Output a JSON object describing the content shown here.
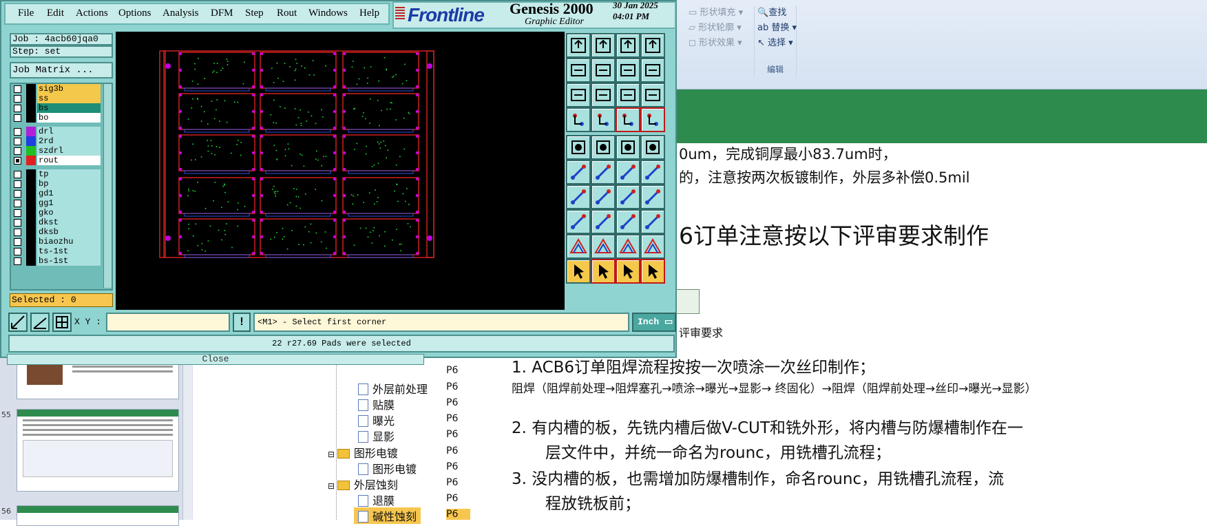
{
  "genesis": {
    "menu": [
      "File",
      "Edit",
      "Actions",
      "Options",
      "Analysis",
      "DFM",
      "Step",
      "Rout",
      "Windows",
      "Help"
    ],
    "brand": "Frontline",
    "product": "Genesis 2000",
    "subtitle": "Graphic Editor",
    "datetime_line1": "30 Jan 2025",
    "datetime_line2": "04:01 PM",
    "job_label": "Job : 4acb60jqa0",
    "step_label": "Step: set",
    "job_matrix_button": "Job Matrix ...",
    "layers": [
      {
        "name": "sig3b",
        "color": "#f4c84a",
        "swatch": "#000000"
      },
      {
        "name": "ss",
        "color": "#f4c84a",
        "swatch": "#000000"
      },
      {
        "name": "bs",
        "color": "#1e8f76",
        "swatch": "#000000"
      },
      {
        "name": "bo",
        "color": "#ffffff",
        "swatch": "#000000"
      },
      {
        "name": "drl",
        "color": "#a9e1de",
        "swatch": "#b020d8"
      },
      {
        "name": "2rd",
        "color": "#a9e1de",
        "swatch": "#2040e0"
      },
      {
        "name": "szdrl",
        "color": "#a9e1de",
        "swatch": "#20c020"
      },
      {
        "name": "rout",
        "color": "#ffffff",
        "swatch": "#e02020"
      },
      {
        "name": "tp",
        "color": "#a9e1de",
        "swatch": "#000000"
      },
      {
        "name": "bp",
        "color": "#a9e1de",
        "swatch": "#000000"
      },
      {
        "name": "gd1",
        "color": "#a9e1de",
        "swatch": "#000000"
      },
      {
        "name": "gg1",
        "color": "#a9e1de",
        "swatch": "#000000"
      },
      {
        "name": "gko",
        "color": "#a9e1de",
        "swatch": "#000000"
      },
      {
        "name": "dkst",
        "color": "#a9e1de",
        "swatch": "#000000"
      },
      {
        "name": "dksb",
        "color": "#a9e1de",
        "swatch": "#000000"
      },
      {
        "name": "biaozhu",
        "color": "#a9e1de",
        "swatch": "#000000"
      },
      {
        "name": "ts-1st",
        "color": "#a9e1de",
        "swatch": "#000000"
      },
      {
        "name": "bs-1st",
        "color": "#a9e1de",
        "swatch": "#000000"
      }
    ],
    "selected_label": "Selected : 0",
    "xy_label": "X Y :",
    "xy_value": "",
    "prompt": "<M1> - Select first corner",
    "units": "Inch",
    "status": "22 r27.69 Pads were selected",
    "close_label": "Close"
  },
  "ribbon": {
    "drawing": [
      "形状填充",
      "形状轮廓",
      "形状效果"
    ],
    "edit": [
      "查找",
      "替换",
      "选择"
    ],
    "edit_group_label": "编辑"
  },
  "document": {
    "line1": "0um，完成铜厚最小83.7um时，",
    "line2": "的，注意按两次板镀制作，外层多补偿0.5mil",
    "heading": "6订单注意按以下评审要求制作",
    "attachment_label": "评审要求",
    "item1": "1.    ACB6订单阻焊流程按按一次喷涂一次丝印制作；",
    "item1_detail": "阻焊（阻焊前处理→阻焊塞孔→喷涂→曝光→显影→ 终固化）→阻焊（阻焊前处理→丝印→曝光→显影）",
    "item2a": "2.  有内槽的板，先铣内槽后做V-CUT和铣外形，将内槽与防爆槽制作在一",
    "item2b": "层文件中，并统一命名为rounc，用铣槽孔流程；",
    "item3a": "3.    没内槽的板，也需增加防爆槽制作，命名rounc，用铣槽孔流程，流",
    "item3b": "程放铣板前；"
  },
  "tree": {
    "items": [
      {
        "label": "外层前处理",
        "code": "P6",
        "folder": false
      },
      {
        "label": "贴膜",
        "code": "P6",
        "folder": false
      },
      {
        "label": "曝光",
        "code": "P6",
        "folder": false
      },
      {
        "label": "显影",
        "code": "P6",
        "folder": false
      },
      {
        "label": "图形电镀",
        "code": "P6",
        "folder": true
      },
      {
        "label": "图形电镀",
        "code": "P6",
        "folder": false
      },
      {
        "label": "外层蚀刻",
        "code": "P6",
        "folder": true
      },
      {
        "label": "退膜",
        "code": "P6",
        "folder": false
      },
      {
        "label": "碱性蚀刻",
        "code": "P6",
        "folder": false
      }
    ],
    "top_code": "P6"
  },
  "slides": {
    "numbers": [
      "55",
      "56"
    ]
  },
  "colors": {
    "window_bg": "#8fd4d0",
    "panel": "#c7ecea",
    "accent_yellow": "#f4c84a",
    "rout_red": "#e02020",
    "doc_green": "#2e8b4e"
  }
}
